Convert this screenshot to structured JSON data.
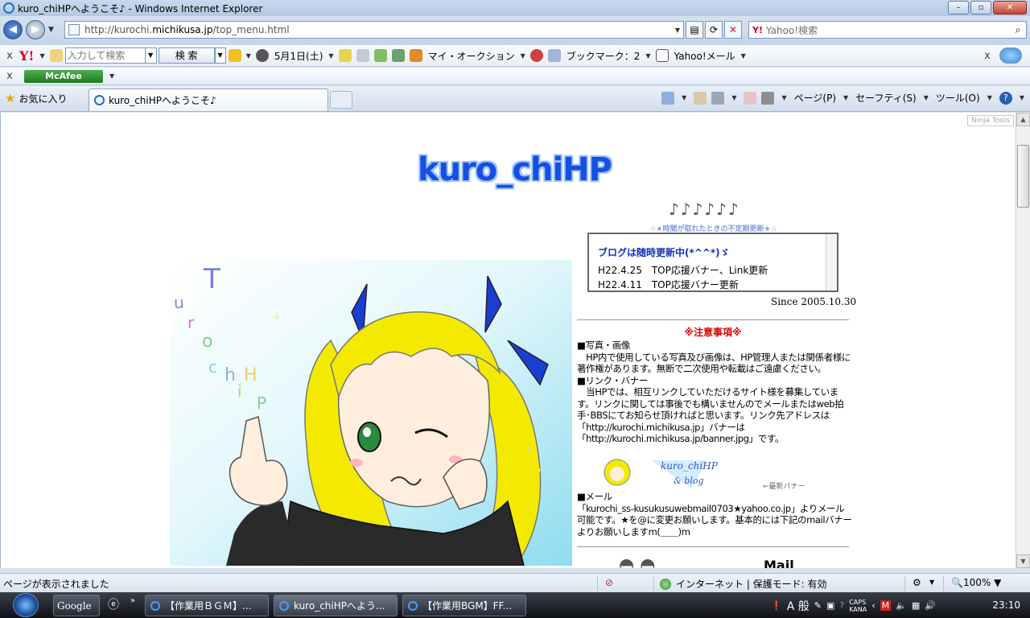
{
  "window": {
    "title": "kuro_chiHPへようこそ♪ - Windows Internet Explorer",
    "minimize": "–",
    "maximize": "▫",
    "close": "✕"
  },
  "address": {
    "url_prefix": "http://kurochi.",
    "url_domain": "michikusa.jp",
    "url_path": "/top_menu.html",
    "search_brand": "Y!",
    "search_placeholder": "Yahoo!検索"
  },
  "yahoo_toolbar": {
    "close": "x",
    "logo": "Y!",
    "input_placeholder": "入力して検索",
    "search_button": "検 索",
    "date": "5月1日(土)",
    "auction": "マイ・オークション",
    "bookmark": "ブックマーク：2",
    "mail": "Yahoo!メール",
    "close_right": "x"
  },
  "mcafee": {
    "close": "x",
    "logo": "McAfee"
  },
  "tabbar": {
    "favorites": "お気に入り",
    "tab_title": "kuro_chiHPへようこそ♪",
    "page_menu": "ページ(P)",
    "safety_menu": "セーフティ(S)",
    "tools_menu": "ツール(O)"
  },
  "page": {
    "ninja": "Ninja Tools",
    "site_title": "kuro_chiHP",
    "update_note": "☆★時間が取れたときの不定期更新★☆",
    "news": {
      "headline": "ブログは随時更新中(*^^*)ゞ",
      "items": [
        "H22.4.25　TOP応援バナー、Link更新",
        "H22.4.11　TOP応援バナー更新"
      ]
    },
    "since": "Since 2005.10.30",
    "notice_title": "※注意事項※",
    "photo_heading": "■写真・画像",
    "photo_text": "　HP内で使用している写真及び画像は、HP管理人または関係者様に著作権があります。無断で二次使用や転載はご遠慮ください。",
    "link_heading": "■リンク・バナー",
    "link_text": "　当HPでは、相互リンクしていただけるサイト様を募集しています。リンクに関しては事後でも構いませんのでメールまたはweb拍手･BBSにてお知らせ頂ければと思います。リンク先アドレスは「http://kurochi.michikusa.jp」バナーは「http://kurochi.michikusa.jp/banner.jpg」です。",
    "banner_caption": "←最新バナー",
    "mail_heading": "■メール",
    "mail_text": "「kurochi_ss-kusukusuwebmail0703★yahoo.co.jp」よりメール可能です。★を@に変更お願いします。基本的には下記のmailバナーよりお願いしますm(＿＿)m",
    "mail_word": "Mail"
  },
  "status": {
    "text": "ページが表示されました",
    "zone": "インターネット | 保護モード: 有効",
    "zoom": "100%"
  },
  "taskbar": {
    "buttons": [
      "Google",
      "【作業用ＢＧＭ】...",
      "kuro_chiHPへよう...",
      "【作業用BGM】FF..."
    ],
    "ime": "A 般",
    "clock": "23:10"
  },
  "colors": {
    "title_blue": "#1550e0",
    "notice_red": "#e00000",
    "news_blue": "#1030c0"
  }
}
